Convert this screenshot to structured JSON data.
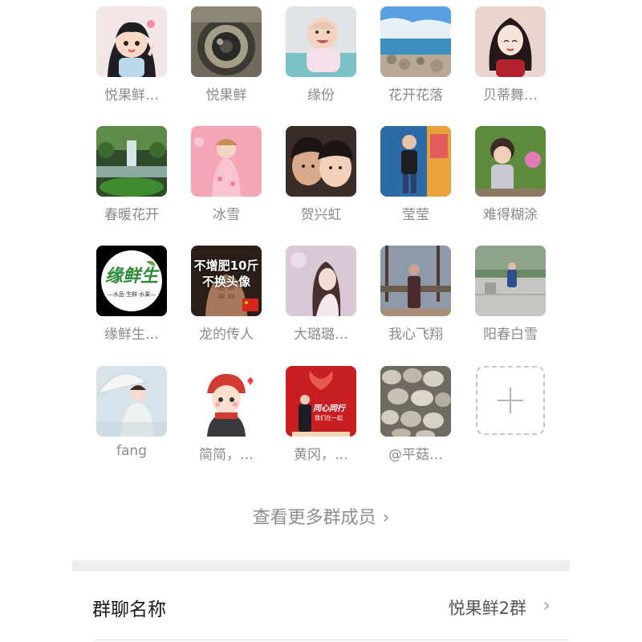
{
  "members": [
    {
      "name": "悦果鲜…",
      "avatar": "cartoon-girl-avatar"
    },
    {
      "name": "悦果鲜",
      "avatar": "camera-lens-photo"
    },
    {
      "name": "缘份",
      "avatar": "baby-photo"
    },
    {
      "name": "花开花落",
      "avatar": "seaside-photo"
    },
    {
      "name": "贝蒂舞…",
      "avatar": "illustrated-woman-avatar"
    },
    {
      "name": "春暖花开",
      "avatar": "waterfall-photo"
    },
    {
      "name": "冰雪",
      "avatar": "woman-pink-background-photo"
    },
    {
      "name": "贺兴虹",
      "avatar": "mother-child-photo"
    },
    {
      "name": "莹莹",
      "avatar": "child-playground-photo"
    },
    {
      "name": "难得糊涂",
      "avatar": "toddler-garden-photo"
    },
    {
      "name": "缘鲜生…",
      "avatar": "yuanxiansheng-logo",
      "logo_text": "缘鲜生",
      "logo_sub": "—水品·生鲜·水果—"
    },
    {
      "name": "龙的传人",
      "avatar": "fitness-text-photo",
      "overlay_line1": "不增肥10斤",
      "overlay_line2": "不换头像"
    },
    {
      "name": "大璐璐…",
      "avatar": "soft-portrait-photo"
    },
    {
      "name": "我心飞翔",
      "avatar": "park-woman-photo"
    },
    {
      "name": "阳春白雪",
      "avatar": "courtyard-photo"
    },
    {
      "name": "fang",
      "avatar": "umbrella-woman-photo"
    },
    {
      "name": "简简，…",
      "avatar": "cartoon-red-hat-avatar"
    },
    {
      "name": "黄冈，…",
      "avatar": "red-poster-avatar",
      "poster_text1": "同心同行",
      "poster_text2": "我们在一起"
    },
    {
      "name": "@平菇…",
      "avatar": "mushrooms-photo"
    }
  ],
  "add_member": {
    "icon": "plus-icon"
  },
  "view_more": {
    "label": "查看更多群成员",
    "icon": "chevron-right-icon"
  },
  "settings": {
    "group_name_label": "群聊名称",
    "group_name_value": "悦果鲜2群"
  }
}
